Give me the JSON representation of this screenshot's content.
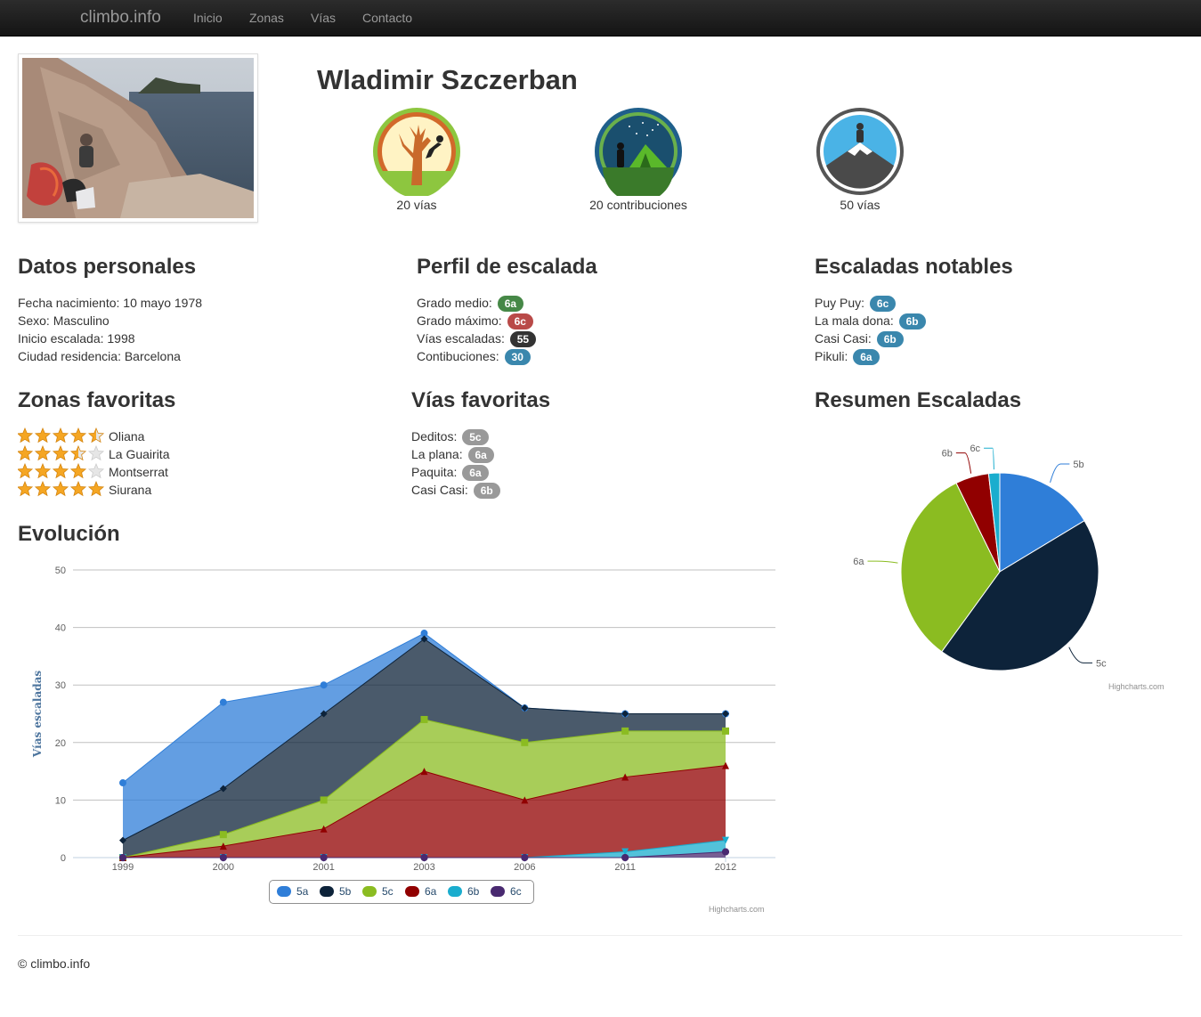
{
  "nav": {
    "brand": "climbo.info",
    "links": [
      "Inicio",
      "Zonas",
      "Vías",
      "Contacto"
    ]
  },
  "profile": {
    "name": "Wladimir Szczerban",
    "badges": [
      {
        "icon": "tree-climber-badge-icon",
        "caption": "20 vías"
      },
      {
        "icon": "tent-badge-icon",
        "caption": "20 contribuciones"
      },
      {
        "icon": "mountain-summit-badge-icon",
        "caption": "50 vías"
      }
    ]
  },
  "datos": {
    "title": "Datos personales",
    "items": [
      "Fecha nacimiento: 10 mayo 1978",
      "Sexo: Masculino",
      "Inicio escalada: 1998",
      "Ciudad residencia: Barcelona"
    ]
  },
  "perfil": {
    "title": "Perfil de escalada",
    "items": [
      {
        "label": "Grado medio:",
        "value": "6a",
        "color": "#468847"
      },
      {
        "label": "Grado máximo:",
        "value": "6c",
        "color": "#b94a48"
      },
      {
        "label": "Vías escaladas:",
        "value": "55",
        "color": "#333333"
      },
      {
        "label": "Contibuciones:",
        "value": "30",
        "color": "#3a87ad"
      }
    ]
  },
  "notables": {
    "title": "Escaladas notables",
    "items": [
      {
        "label": "Puy Puy:",
        "value": "6c"
      },
      {
        "label": "La mala dona:",
        "value": "6b"
      },
      {
        "label": "Casi Casi:",
        "value": "6b"
      },
      {
        "label": "Pikuli:",
        "value": "6a"
      }
    ],
    "color": "#3a87ad"
  },
  "zonas": {
    "title": "Zonas favoritas",
    "items": [
      {
        "name": "Oliana",
        "rating": 4.5
      },
      {
        "name": "La Guairita",
        "rating": 3.5
      },
      {
        "name": "Montserrat",
        "rating": 4
      },
      {
        "name": "Siurana",
        "rating": 5
      }
    ]
  },
  "vias": {
    "title": "Vías favoritas",
    "items": [
      {
        "label": "Deditos:",
        "value": "5c"
      },
      {
        "label": "La plana:",
        "value": "6a"
      },
      {
        "label": "Paquita:",
        "value": "6a"
      },
      {
        "label": "Casi Casi:",
        "value": "6b"
      }
    ],
    "color": "#999999"
  },
  "resumen": {
    "title": "Resumen Escaladas"
  },
  "evolucion": {
    "title": "Evolución"
  },
  "highcharts_credit": "Highcharts.com",
  "footer": "© climbo.info",
  "chart_data": [
    {
      "type": "area",
      "stacked": true,
      "title": "",
      "ylabel": "Vías escaladas",
      "categories": [
        "1999",
        "2000",
        "2001",
        "2003",
        "2006",
        "2011",
        "2012"
      ],
      "ylim": [
        0,
        50
      ],
      "yticks": [
        0,
        10,
        20,
        30,
        40,
        50
      ],
      "grid": true,
      "legend": "bottom-center",
      "series": [
        {
          "name": "5a",
          "color": "#2f7ed8",
          "values": [
            10,
            15,
            5,
            1,
            0,
            0,
            0
          ]
        },
        {
          "name": "5b",
          "color": "#0d233a",
          "values": [
            3,
            8,
            15,
            14,
            6,
            3,
            3
          ]
        },
        {
          "name": "5c",
          "color": "#8bbc21",
          "values": [
            0,
            2,
            5,
            9,
            10,
            8,
            6
          ]
        },
        {
          "name": "6a",
          "color": "#910000",
          "values": [
            0,
            2,
            5,
            15,
            10,
            13,
            13
          ]
        },
        {
          "name": "6b",
          "color": "#1aadce",
          "values": [
            0,
            0,
            0,
            0,
            0,
            1,
            2
          ]
        },
        {
          "name": "6c",
          "color": "#492970",
          "values": [
            0,
            0,
            0,
            0,
            0,
            0,
            1
          ]
        }
      ]
    },
    {
      "type": "pie",
      "title": "",
      "labels": [
        "5b",
        "5c",
        "6a",
        "6b",
        "6c"
      ],
      "values": [
        9,
        24,
        18,
        3,
        1
      ],
      "colors": [
        "#2f7ed8",
        "#0d233a",
        "#8bbc21",
        "#910000",
        "#1aadce"
      ]
    }
  ]
}
